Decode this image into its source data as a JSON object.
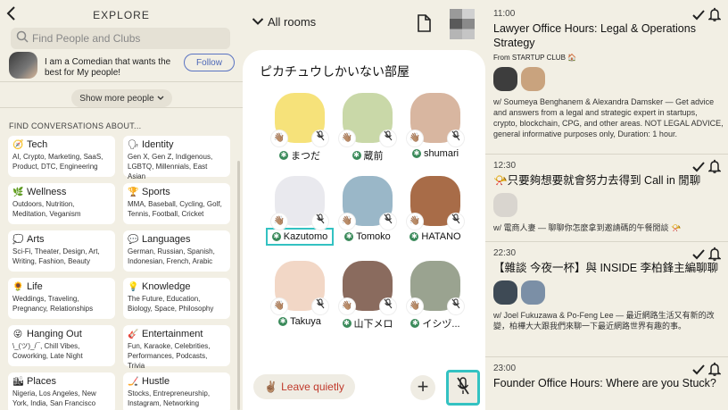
{
  "explore": {
    "back_label": "‹",
    "title": "EXPLORE",
    "search_placeholder": "Find People and Clubs",
    "profile": {
      "bio": "I am a Comedian that wants the best for My people!",
      "follow_label": "Follow"
    },
    "show_more_label": "Show more people",
    "find_label": "FIND CONVERSATIONS ABOUT...",
    "topics": [
      {
        "icon": "🧭",
        "name": "Tech",
        "sub": "AI, Crypto, Marketing, SaaS, Product, DTC, Engineering"
      },
      {
        "icon": "🗣",
        "name": "Identity",
        "sub": "Gen X, Gen Z, Indigenous, LGBTQ, Millennials, East Asian"
      },
      {
        "icon": "🌿",
        "name": "Wellness",
        "sub": "Outdoors, Nutrition, Meditation, Veganism"
      },
      {
        "icon": "🏆",
        "name": "Sports",
        "sub": "MMA, Baseball, Cycling, Golf, Tennis, Football, Cricket"
      },
      {
        "icon": "💭",
        "name": "Arts",
        "sub": "Sci-Fi, Theater, Design, Art, Writing, Fashion, Beauty"
      },
      {
        "icon": "💬",
        "name": "Languages",
        "sub": "German, Russian, Spanish, Indonesian, French, Arabic"
      },
      {
        "icon": "🌻",
        "name": "Life",
        "sub": "Weddings, Traveling, Pregnancy, Relationships"
      },
      {
        "icon": "💡",
        "name": "Knowledge",
        "sub": "The Future, Education, Biology, Space, Philosophy"
      },
      {
        "icon": "😜",
        "name": "Hanging Out",
        "sub": "\\_(ツ)_/¯, Chill Vibes, Coworking, Late Night"
      },
      {
        "icon": "🎸",
        "name": "Entertainment",
        "sub": "Fun, Karaoke, Celebrities, Performances, Podcasts, Trivia"
      },
      {
        "icon": "🏙",
        "name": "Places",
        "sub": "Nigeria, Los Angeles, New York, India, San Francisco"
      },
      {
        "icon": "🏒",
        "name": "Hustle",
        "sub": "Stocks, Entrepreneurship, Instagram, Networking"
      }
    ]
  },
  "room": {
    "all_rooms_label": "All rooms",
    "title": "ピカチュウしかいない部屋",
    "speakers": [
      {
        "name": "まつだ",
        "color": "#f6e27a",
        "mod": true
      },
      {
        "name": "蔵前",
        "color": "#c9d8a8",
        "mod": true
      },
      {
        "name": "shumari",
        "color": "#d8b6a0",
        "mod": true
      },
      {
        "name": "Kazutomo",
        "color": "#e9e9ee",
        "mod": true,
        "highlight": true
      },
      {
        "name": "Tomoko",
        "color": "#9ab7c8",
        "mod": true
      },
      {
        "name": "HATANO",
        "color": "#a86c48",
        "mod": true
      },
      {
        "name": "Takuya",
        "color": "#f2d7c6",
        "mod": true
      },
      {
        "name": "山下メロ",
        "color": "#8a6b5e",
        "mod": true
      },
      {
        "name": "イシヅ...",
        "color": "#9aa390",
        "mod": true
      }
    ],
    "leave_label": "Leave quietly",
    "leave_emoji": "✌🏽",
    "plus_label": "+",
    "hand_emoji": "👋🏽",
    "mic_emoji": "🎙"
  },
  "events": [
    {
      "time": "11:00",
      "title": "Lawyer Office Hours: Legal & Operations Strategy",
      "from": "From STARTUP CLUB 🏠",
      "faces": [
        "#3d3d3d",
        "#c9a37e"
      ],
      "desc": "w/ Soumeya Benghanem & Alexandra Damsker — Get advice and answers from a legal and strategic expert in startups, crypto, blockchain, CPG, and other areas. NOT LEGAL ADVICE, general informative purposes only, Duration: 1 hour."
    },
    {
      "time": "12:30",
      "title": "📯只要夠想要就會努力去得到 Call in 閒聊",
      "from": "",
      "faces": [
        "#d9d5cf"
      ],
      "desc": "w/ 電商人妻 — 聊聊你怎麼拿到邀請碼的午餐閒談 📯"
    },
    {
      "time": "22:30",
      "title": "【雜談 今夜一杯】與 INSIDE 李柏鋒主編聊聊",
      "from": "",
      "faces": [
        "#3e4a55",
        "#7b8fa6"
      ],
      "desc": "w/ Joel Fukuzawa & Po-Feng Lee — 最近網路生活又有新的改變，柏樺大大跟我們來聊一下最近網路世界有趣的事。"
    },
    {
      "time": "23:00",
      "title": "Founder Office Hours: Where are you Stuck?",
      "from": "",
      "faces": [],
      "desc": ""
    }
  ],
  "event_actions": {
    "check": "✓",
    "bell": "🔔"
  }
}
